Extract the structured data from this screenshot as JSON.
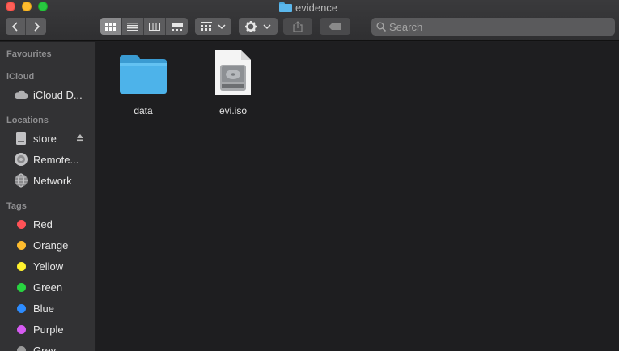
{
  "window": {
    "title": "evidence"
  },
  "toolbar": {
    "search_placeholder": "Search",
    "back_icon": "chevron-left-icon",
    "forward_icon": "chevron-right-icon",
    "view_modes": [
      "icon-view",
      "list-view",
      "column-view",
      "gallery-view"
    ],
    "active_view": "icon-view"
  },
  "sidebar": {
    "favourites_title": "Favourites",
    "icloud_title": "iCloud",
    "icloud_items": [
      {
        "label": "iCloud D...",
        "icon": "cloud-icon"
      }
    ],
    "locations_title": "Locations",
    "locations_items": [
      {
        "label": "store",
        "icon": "disk-icon"
      },
      {
        "label": "Remote...",
        "icon": "remote-disc-icon"
      },
      {
        "label": "Network",
        "icon": "globe-icon"
      }
    ],
    "tags_title": "Tags",
    "tags": [
      {
        "label": "Red",
        "color": "#ff5257"
      },
      {
        "label": "Orange",
        "color": "#febc2e"
      },
      {
        "label": "Yellow",
        "color": "#fff22e"
      },
      {
        "label": "Green",
        "color": "#28d440"
      },
      {
        "label": "Blue",
        "color": "#2d8cff"
      },
      {
        "label": "Purple",
        "color": "#d65bf2"
      },
      {
        "label": "Grey",
        "color": "#9a9a9a"
      }
    ]
  },
  "files": [
    {
      "name": "data",
      "type": "folder",
      "icon": "folder-icon"
    },
    {
      "name": "evi.iso",
      "type": "disk-image",
      "icon": "disk-image-icon"
    }
  ],
  "colors": {
    "accent": "#5bb7ec",
    "background": "#1e1e20",
    "sidebar": "#323234"
  }
}
